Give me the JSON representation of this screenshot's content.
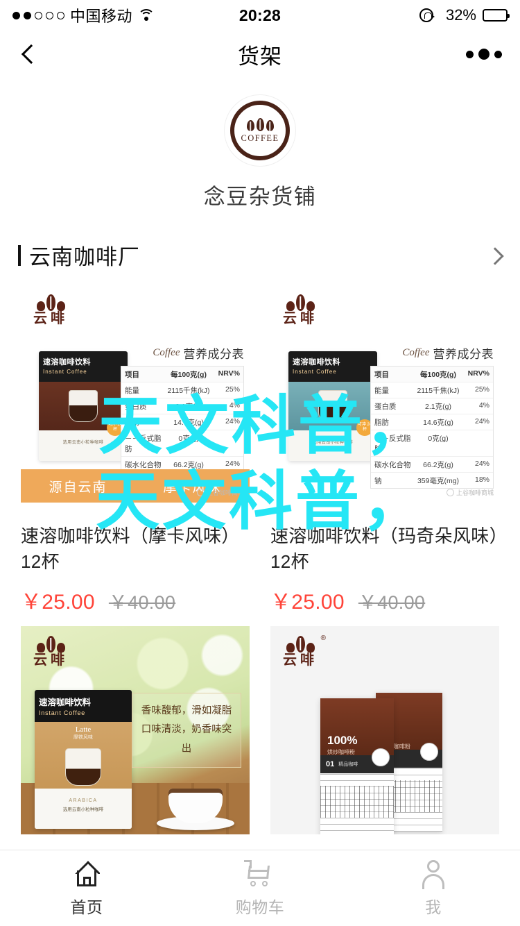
{
  "status_bar": {
    "signal_dots_filled": 2,
    "signal_dots_total": 5,
    "carrier": "中国移动",
    "wifi_icon": "wifi-icon",
    "time": "20:28",
    "rotation_lock_icon": "rotation-lock-icon",
    "location_icon": "location-arrow-icon",
    "battery_percent": "32%",
    "battery_level": 32
  },
  "nav_bar": {
    "back_icon": "back-chevron-icon",
    "title": "货架",
    "more_icon": "more-dots-icon"
  },
  "shop": {
    "logo_word": "COFFEE",
    "logo_icon": "coffee-bean-logo",
    "name": "念豆杂货铺"
  },
  "section": {
    "title": "云南咖啡厂",
    "arrow_icon": "chevron-right-icon"
  },
  "watermark": {
    "line1": "天文科普，",
    "line2": "天文科普，",
    "color": "#25e6f5"
  },
  "brand": {
    "name": "云啡",
    "registered": "®",
    "shop_mark": "上谷咖啡商城"
  },
  "nutrition": {
    "script_label": "Coffee",
    "title": "营养成分表",
    "columns": [
      "项目",
      "每100克(g)",
      "NRV%"
    ],
    "rows": [
      {
        "item": "能量",
        "value": "2115千焦(kJ)",
        "nrv": "25%"
      },
      {
        "item": "蛋白质",
        "value": "2.1克(g)",
        "nrv": "4%"
      },
      {
        "item": "脂肪",
        "value": "14.6克(g)",
        "nrv": "24%"
      },
      {
        "item": "－－反式脂肪",
        "value": "0克(g)",
        "nrv": ""
      },
      {
        "item": "碳水化合物",
        "value": "66.2克(g)",
        "nrv": "24%"
      },
      {
        "item": "钠",
        "value": "359毫克(mg)",
        "nrv": "18%"
      }
    ]
  },
  "banner": {
    "left": "源自云南",
    "right": "摩卡风味"
  },
  "box_art": {
    "title_cn": "速溶咖啡饮料",
    "title_en": "Instant Coffee",
    "variant": "Latte",
    "variant_cn": "摩铁风味",
    "arabica": "ARABICA",
    "desc_cn": "选用云南小粒种咖啡",
    "badge": "可冲 24杯"
  },
  "promo": {
    "line1": "香味馥郁，滑如凝脂",
    "line2": "口味清淡，奶香味突出"
  },
  "bag_art": {
    "percent": "100%",
    "sub": "烘炒咖啡粉",
    "number": "01",
    "label": "精品咖啡"
  },
  "products": [
    {
      "title": "速溶咖啡饮料（摩卡风味）12杯",
      "price": "￥25.00",
      "original_price": "￥40.00"
    },
    {
      "title": "速溶咖啡饮料（玛奇朵风味）12杯",
      "price": "￥25.00",
      "original_price": "￥40.00"
    },
    {
      "title": "",
      "price": "",
      "original_price": ""
    },
    {
      "title": "",
      "price": "",
      "original_price": ""
    }
  ],
  "tab_bar": {
    "items": [
      {
        "label": "首页",
        "icon": "home-icon",
        "active": true
      },
      {
        "label": "购物车",
        "icon": "cart-icon",
        "active": false
      },
      {
        "label": "我",
        "icon": "user-icon",
        "active": false
      }
    ]
  }
}
